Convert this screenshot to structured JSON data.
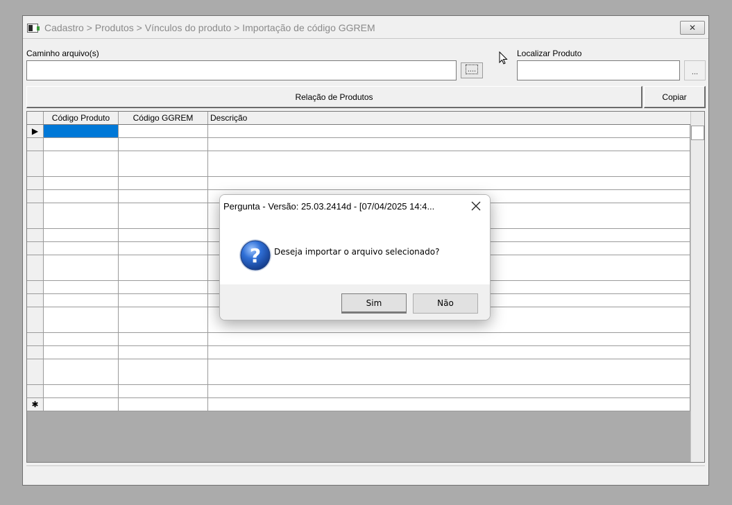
{
  "window": {
    "title": "Cadastro > Produtos > Vínculos do produto > Importação de código GGREM",
    "close_symbol": "✕"
  },
  "form": {
    "path_label": "Caminho arquivo(s)",
    "path_value": "",
    "browse_label": "....",
    "find_label": "Localizar Produto",
    "find_value": "",
    "find_browse_label": "...",
    "product_list_label": "Relação de Produtos",
    "copy_label": "Copiar"
  },
  "grid": {
    "columns": [
      "Código Produto",
      "Código GGREM",
      "Descrição"
    ],
    "current_row_marker": "▶",
    "new_row_marker": "✱",
    "empty_rows": 21,
    "selected_cell_color": "#0078d7"
  },
  "dialog": {
    "title": "Pergunta - Versão: 25.03.2414d - [07/04/2025 14:4...",
    "close_symbol": "✕",
    "icon": "question-icon",
    "message": "Deseja importar o arquivo selecionado?",
    "yes_label": "Sim",
    "no_label": "Não"
  }
}
